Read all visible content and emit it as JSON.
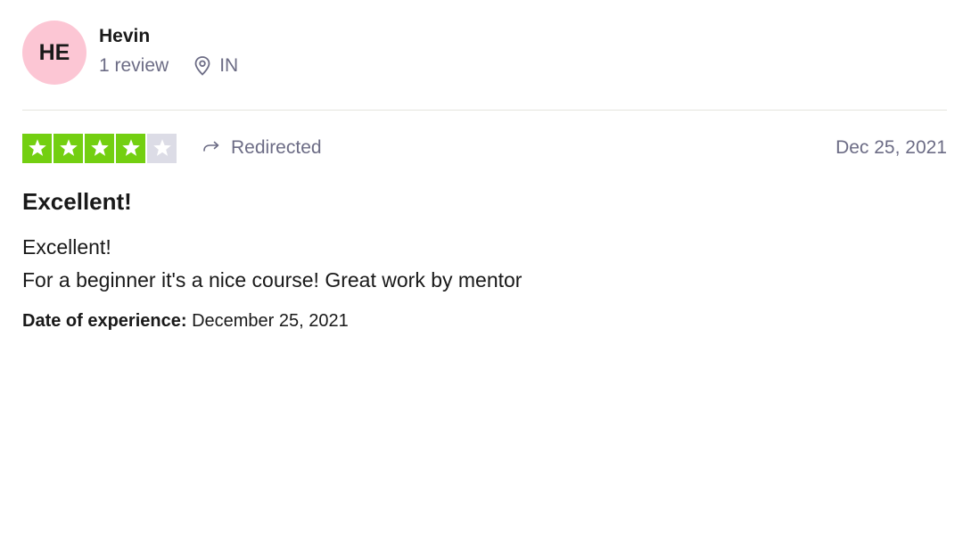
{
  "consumer": {
    "initials": "HE",
    "name": "Hevin",
    "review_count": "1 review",
    "country": "IN",
    "avatar_color": "#fcc6d4"
  },
  "review": {
    "rating": 4,
    "max_rating": 5,
    "star_filled_color": "#73cf11",
    "star_empty_color": "#dcdce6",
    "verification_label": "Redirected",
    "verification_icon": "redirect-arrow-icon",
    "date": "Dec 25, 2021",
    "title": "Excellent!",
    "body_lines": [
      "Excellent!",
      "For a beginner it's a nice course! Great work by mentor"
    ],
    "experience_label": "Date of experience:",
    "experience_date": "December 25, 2021"
  }
}
